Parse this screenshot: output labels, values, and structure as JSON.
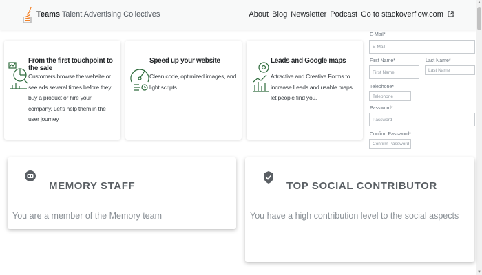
{
  "header": {
    "brand_main": "Teams",
    "brand_rest": "Talent Advertising Collectives",
    "nav": [
      "About",
      "Blog",
      "Newsletter",
      "Podcast",
      "Go to stackoverflow.com"
    ],
    "logo_color": "#f48024"
  },
  "features": [
    {
      "title": "From the first touchpoint to the sale",
      "description": "Customers browse the website or see ads several times before they buy a product or hire your company. Let's help them in the user journey",
      "icon": "analytics-icon"
    },
    {
      "title": "Speed up your website",
      "description": "Clean code, optimized images, and light scripts.",
      "icon": "speedometer-icon"
    },
    {
      "title": "Leads and Google maps",
      "description": "Attractive and Creative Forms to increase Leads and usable maps let people find you.",
      "icon": "map-pin-growth-icon"
    }
  ],
  "form": {
    "email_label": "E-Mail*",
    "email_placeholder": "E-Mail",
    "first_name_label": "First Name*",
    "first_name_placeholder": "First Name",
    "last_name_label": "Last Name*",
    "last_name_placeholder": "Last Name",
    "telephone_label": "Telephone*",
    "telephone_placeholder": "Telephone",
    "password_label": "Password*",
    "password_placeholder": "Password",
    "confirm_label": "Confirm Password*",
    "confirm_placeholder": "Confirm Password"
  },
  "badges": [
    {
      "title": "MEMORY STAFF",
      "description": "You are a member of the Memory team",
      "icon": "memory-chip-icon"
    },
    {
      "title": "TOP SOCIAL CONTRIBUTOR",
      "description": "You have a high contribution level to the social aspects",
      "icon": "shield-check-icon"
    }
  ],
  "colors": {
    "icon_green": "#2e6b3c",
    "badge_title": "#5a5f64"
  }
}
